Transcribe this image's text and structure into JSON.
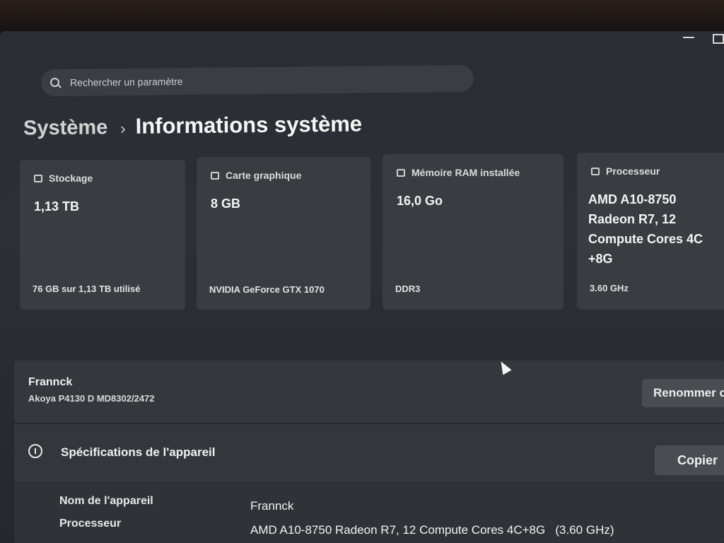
{
  "search": {
    "placeholder": "Rechercher un paramètre"
  },
  "breadcrumb": {
    "parent": "Système",
    "separator": "›",
    "title": "Informations système"
  },
  "cards": [
    {
      "label": "Stockage",
      "value": "1,13 TB",
      "detail": "76 GB sur 1,13 TB utilisé",
      "icon": "storage-icon"
    },
    {
      "label": "Carte graphique",
      "value": "8 GB",
      "detail": "NVIDIA GeForce GTX 1070",
      "icon": "gpu-icon"
    },
    {
      "label": "Mémoire RAM installée",
      "value": "16,0 Go",
      "detail": "DDR3",
      "icon": "ram-icon"
    },
    {
      "label": "Processeur",
      "value": "AMD A10-8750 Radeon R7, 12 Compute Cores 4C +8G",
      "detail": "3.60 GHz",
      "icon": "cpu-icon"
    }
  ],
  "device": {
    "name": "Frannck",
    "model": "Akoya P4130 D MD8302/2472",
    "rename_label": "Renommer c"
  },
  "specs": {
    "title": "Spécifications de l'appareil",
    "copy_label": "Copier",
    "rows": [
      {
        "label": "Nom de l'appareil",
        "value": "Frannck"
      },
      {
        "label": "Processeur",
        "value": "AMD A10-8750 Radeon R7, 12 Compute Cores 4C+8G   (3.60 GHz)"
      }
    ]
  }
}
